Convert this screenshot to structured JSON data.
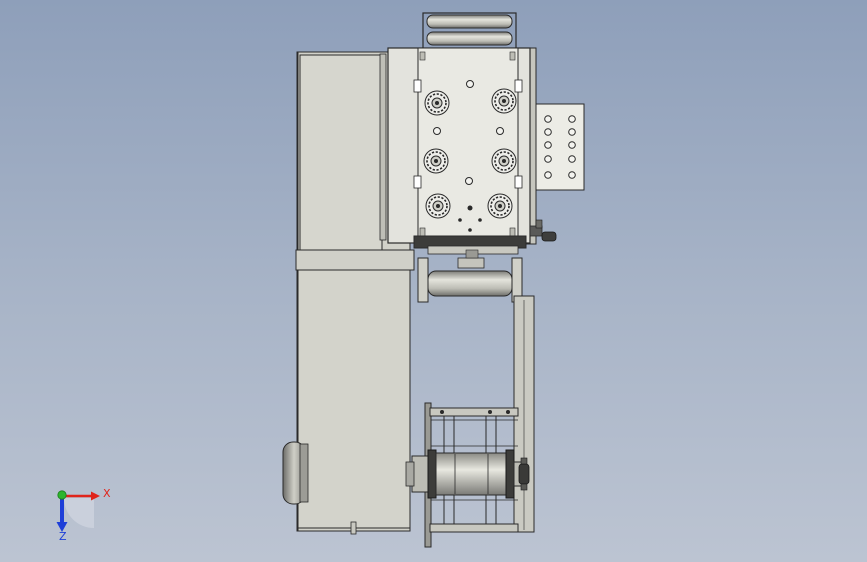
{
  "triad": {
    "x_label": "X",
    "y_label": "Z",
    "x_color": "#e0241b",
    "y_color": "#1e3fd8",
    "origin_color": "#2db52d"
  },
  "colors": {
    "background_top": "#8e9fba",
    "background_bottom": "#bcc4d2",
    "body_fill": "#d4d4cc",
    "panel_fill": "#e6e6e0",
    "edge": "#2a2a2a"
  },
  "icons": [
    "roller-icon",
    "gear-icon",
    "handwheel-icon",
    "indicator-light-icon",
    "lever-icon"
  ]
}
